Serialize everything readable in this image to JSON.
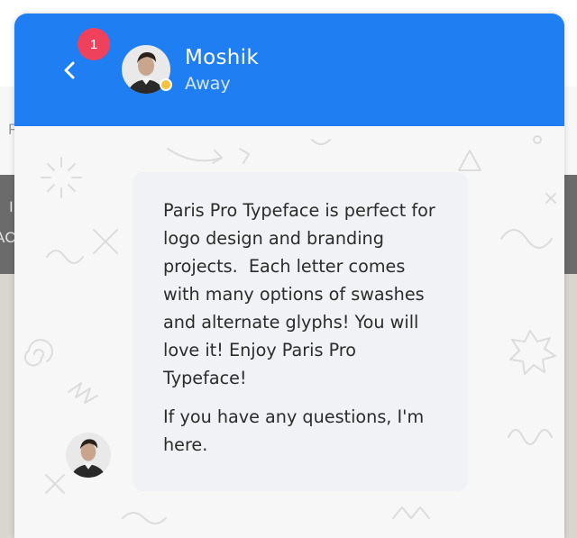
{
  "background": {
    "fragments": [
      "F",
      "I",
      "AC"
    ]
  },
  "chat": {
    "header": {
      "back_icon": "chevron-left-icon",
      "unread_badge": "1",
      "agent_name": "Moshik",
      "agent_status": "Away",
      "status_color": "#f5c23c",
      "header_color": "#1e7ef2"
    },
    "message": {
      "paragraphs": [
        "Paris Pro Typeface is perfect for logo design and branding projects.  Each letter comes with many options of swashes and alternate glyphs! You will love it! Enjoy Paris Pro Typeface!",
        "If you have any questions, I'm here."
      ]
    }
  }
}
